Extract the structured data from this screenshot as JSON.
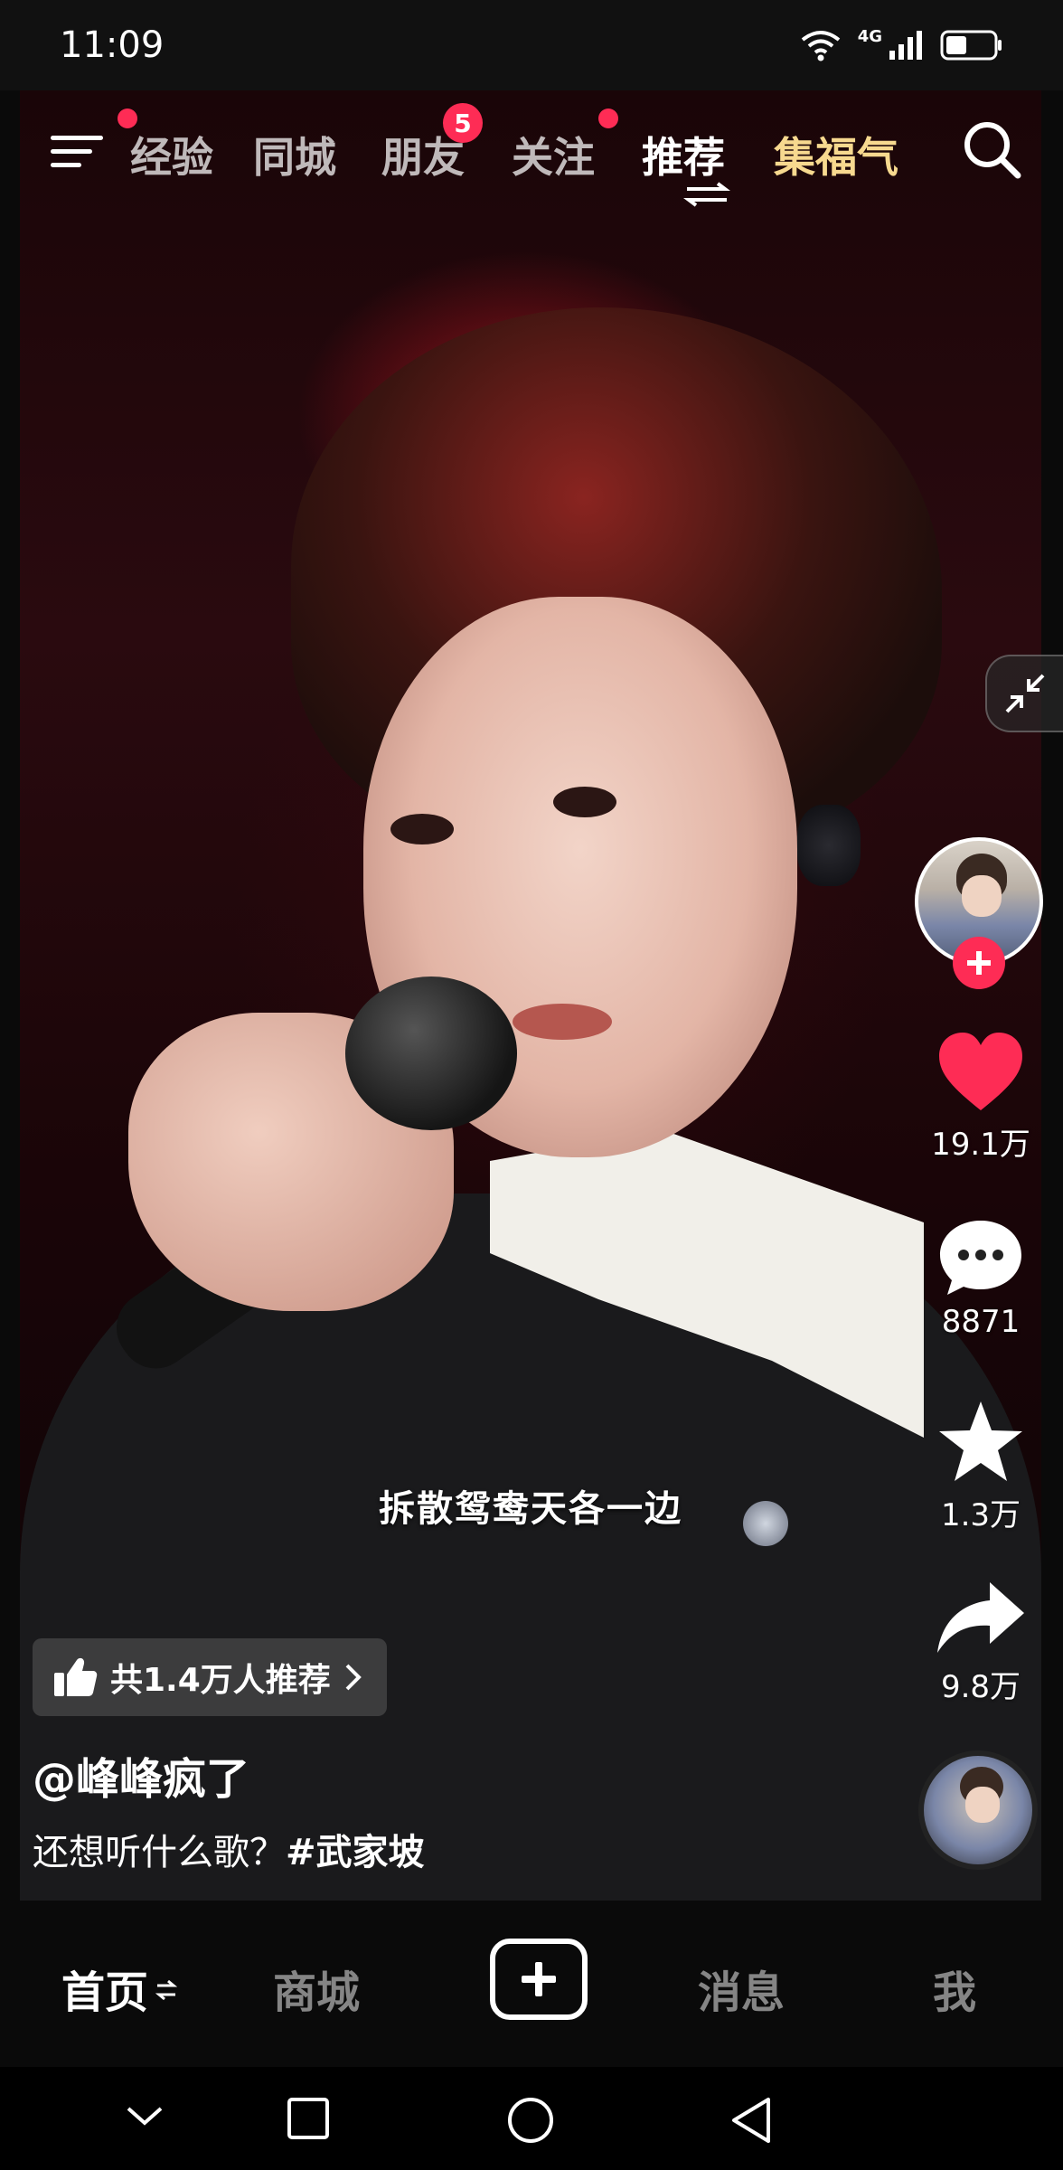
{
  "status_bar": {
    "time": "11:09",
    "network": "4G",
    "icons": [
      "wifi-icon",
      "signal-icon",
      "battery-icon"
    ]
  },
  "top_nav": {
    "tabs": [
      {
        "label": "经验",
        "has_dot": true
      },
      {
        "label": "同城"
      },
      {
        "label": "朋友",
        "badge": "5"
      },
      {
        "label": "关注",
        "has_dot": true
      },
      {
        "label": "推荐",
        "active": true
      },
      {
        "label": "集福气",
        "festive": true
      }
    ]
  },
  "video": {
    "subtitle": "拆散鸳鸯天各一边"
  },
  "actions": {
    "likes": "19.1万",
    "comments": "8871",
    "favorites": "1.3万",
    "shares": "9.8万"
  },
  "caption": {
    "recommend": "共1.4万人推荐",
    "author": "@峰峰疯了",
    "text": "还想听什么歌？",
    "hashtag": "#武家坡"
  },
  "bottom_tabs": {
    "home": "首页",
    "mall": "商城",
    "messages": "消息",
    "me": "我"
  },
  "colors": {
    "accent": "#fe2c55",
    "festive": "#f7d98f",
    "background": "#0a0a0a"
  }
}
